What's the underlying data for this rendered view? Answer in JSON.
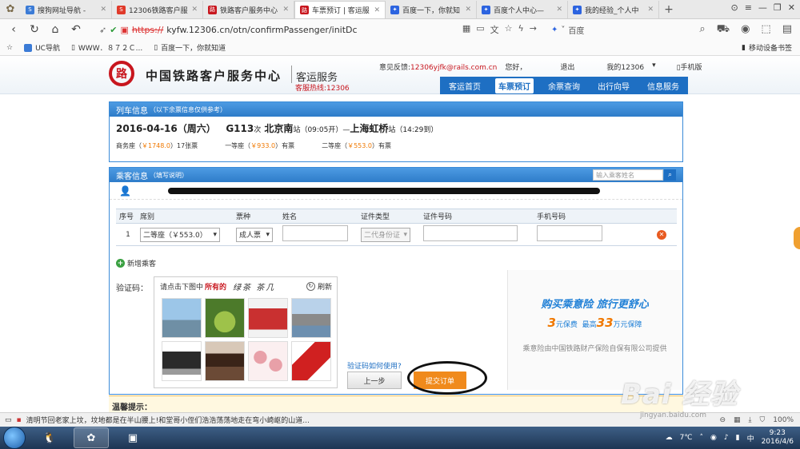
{
  "browser": {
    "tabs": [
      {
        "label": "搜狗网址导航 - ",
        "color": "#3b7bd6",
        "icon": "sogou-icon"
      },
      {
        "label": "12306铁路客户服",
        "color": "#e03a2a",
        "icon": "s-icon"
      },
      {
        "label": "铁路客户服务中心",
        "color": "#c8161e",
        "icon": "railway-icon"
      },
      {
        "label": "车票预订 | 客运服",
        "color": "#c8161e",
        "icon": "railway-icon",
        "active": true
      },
      {
        "label": "百度一下，你就知",
        "color": "#2d64e0",
        "icon": "baidu-paw-icon"
      },
      {
        "label": "百度个人中心—",
        "color": "#2d64e0",
        "icon": "baidu-paw-icon"
      },
      {
        "label": "我的经验_个人中",
        "color": "#2d64e0",
        "icon": "baidu-paw-icon"
      }
    ],
    "url_proto": "https://",
    "url_rest": "kyfw.12306.cn/otn/confirmPassenger/initDc",
    "search_engine": "百度",
    "bookmarks": [
      "UC导航",
      "WWW．８７２Ｃ...",
      "百度一下，你就知道"
    ],
    "bookmarks_right": "移动设备书签"
  },
  "site": {
    "logo_char": "路",
    "title": "中国铁路客户服务中心",
    "subtitle": "客运服务",
    "hotline": "客服热线:12306",
    "feedback_label": "意见反馈:",
    "feedback_email": "12306yjfk@rails.com.cn",
    "greeting": "您好，",
    "logout": "退出",
    "my12306": "我的12306",
    "mobile": "手机版",
    "nav": [
      "客运首页",
      "车票预订",
      "余票查询",
      "出行向导",
      "信息服务"
    ]
  },
  "train": {
    "head": "列车信息",
    "head_note": "（以下余票信息仅供参考）",
    "date": "2016-04-16（周六）",
    "number": "G113",
    "number_suffix": "次",
    "from": "北京南",
    "from_suffix": "站（09:05开）—",
    "to": "上海虹桥",
    "to_suffix": "站",
    "arrive": "（14:29到）",
    "seats": [
      {
        "name": "商务座（",
        "price": "￥1748.0",
        "close": "）",
        "avail": "17张票"
      },
      {
        "name": "一等座（",
        "price": "￥933.0",
        "close": "）",
        "avail": "有票"
      },
      {
        "name": "二等座（",
        "price": "￥553.0",
        "close": "）",
        "avail": "有票"
      }
    ]
  },
  "passenger": {
    "head": "乘客信息",
    "head_note": "（填写说明）",
    "search_placeholder": "输入乘客姓名",
    "columns": [
      "序号",
      "席别",
      "票种",
      "姓名",
      "证件类型",
      "证件号码",
      "手机号码"
    ],
    "row": {
      "index": "1",
      "seat": "二等座（￥553.0）",
      "ticket": "成人票",
      "id_type": "二代身份证"
    },
    "add": "新增乘客"
  },
  "captcha": {
    "label": "验证码：",
    "prompt": "请点击下图中",
    "prompt_em": "所有的",
    "handwritten": "绿茶  茶几",
    "refresh": "刷新"
  },
  "insurance": {
    "title": "购买乘意险  旅行更舒心",
    "price": "3",
    "price_unit": "元保费",
    "max_label": "最高",
    "max": "33",
    "max_unit": "万元保障",
    "note": "乘意险由中国铁路财产保险自保有限公司提供"
  },
  "actions": {
    "help": "验证码如何使用?",
    "prev": "上一步",
    "submit": "提交订单"
  },
  "tips": "温馨提示：",
  "status": {
    "news": "清明节回老家上坟，坟地都是在半山腰上!和堂哥小侄们浩浩荡荡地走在弯小崎岖的山道...",
    "zoom": "100%"
  },
  "taskbar": {
    "weather": "7℃",
    "time": "9:23",
    "date": "2016/4/6"
  },
  "watermark": "Bai 经验",
  "watermark_sub": "jingyan.baidu.com"
}
